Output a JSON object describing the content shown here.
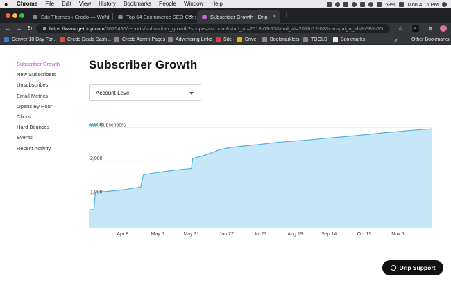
{
  "menubar": {
    "app": "Chrome",
    "items": [
      "File",
      "Edit",
      "View",
      "History",
      "Bookmarks",
      "People",
      "Window",
      "Help"
    ],
    "battery": "68%",
    "clock": "Mon 4:16 PM"
  },
  "tabs": [
    {
      "title": "Edit Themes ‹ Credo — WordPr",
      "active": false
    },
    {
      "title": "Top 64 Ecommerce SEO Consu",
      "active": false
    },
    {
      "title": "Subscriber Growth - Drip",
      "active": true
    }
  ],
  "address": {
    "host": "https://www.getdrip.com",
    "path": "/3675496/reports/subscriber_growth?scope=account&start_at=2018-03-13&end_at=2018-12-02&campaign_ids%5B%5D",
    "ext_badge": "JB+"
  },
  "bookmarks": [
    {
      "label": "Denver 10 Day For...",
      "color": "#3b7bd4"
    },
    {
      "label": "Credo Deals Dash...",
      "color": "#d94c3a"
    },
    {
      "label": "Credo Admin Pages",
      "color": "#8a8a8a"
    },
    {
      "label": "Advertising Links",
      "color": "#8a8a8a"
    },
    {
      "label": "Site",
      "color": "#e23b3b"
    },
    {
      "label": "Drive",
      "color": "#f4b400"
    },
    {
      "label": "Bookmarklets",
      "color": "#8a8a8a"
    },
    {
      "label": "TOOLS",
      "color": "#8a8a8a"
    },
    {
      "label": "Bookmarks",
      "color": "#e8eaed"
    }
  ],
  "bookmarks_more": "»",
  "bookmarks_other": "Other Bookmarks",
  "sidebar": {
    "items": [
      {
        "label": "Subscriber Growth",
        "active": true
      },
      {
        "label": "New Subscribers",
        "active": false
      },
      {
        "label": "Unsubscribes",
        "active": false
      },
      {
        "label": "Email Metrics",
        "active": false
      },
      {
        "label": "Opens By Hour",
        "active": false
      },
      {
        "label": "Clicks",
        "active": false
      },
      {
        "label": "Hard Bounces",
        "active": false
      },
      {
        "label": "Events",
        "active": false
      },
      {
        "label": "Recent Activity",
        "active": false
      }
    ]
  },
  "page_title": "Subscriber Growth",
  "scope_select": {
    "value": "Account Level"
  },
  "colors": {
    "accent": "#d63fe0",
    "series_line": "#4fb3e0",
    "series_fill": "#c6e7f8"
  },
  "support_button": {
    "label": "Drip Support"
  },
  "chart_data": {
    "type": "area",
    "series": [
      {
        "name": "Subscribers",
        "points": [
          [
            "2018-03-13",
            550
          ],
          [
            "2018-03-17",
            560
          ],
          [
            "2018-03-18",
            1080
          ],
          [
            "2018-03-27",
            1100
          ],
          [
            "2018-04-03",
            1130
          ],
          [
            "2018-04-10",
            1160
          ],
          [
            "2018-04-17",
            1200
          ],
          [
            "2018-04-22",
            1230
          ],
          [
            "2018-04-24",
            1590
          ],
          [
            "2018-05-01",
            1640
          ],
          [
            "2018-05-10",
            1690
          ],
          [
            "2018-05-20",
            1740
          ],
          [
            "2018-05-31",
            1780
          ],
          [
            "2018-06-01",
            2080
          ],
          [
            "2018-06-08",
            2150
          ],
          [
            "2018-06-15",
            2240
          ],
          [
            "2018-06-22",
            2340
          ],
          [
            "2018-06-29",
            2400
          ],
          [
            "2018-07-10",
            2450
          ],
          [
            "2018-07-23",
            2500
          ],
          [
            "2018-08-05",
            2560
          ],
          [
            "2018-08-19",
            2600
          ],
          [
            "2018-09-01",
            2640
          ],
          [
            "2018-09-14",
            2690
          ],
          [
            "2018-09-24",
            2720
          ],
          [
            "2018-10-05",
            2760
          ],
          [
            "2018-10-15",
            2800
          ],
          [
            "2018-10-27",
            2850
          ],
          [
            "2018-11-06",
            2880
          ],
          [
            "2018-11-18",
            2920
          ],
          [
            "2018-12-02",
            2960
          ]
        ]
      }
    ],
    "x_ticks": [
      {
        "date": "2018-04-08",
        "label": "Apr 8"
      },
      {
        "date": "2018-05-05",
        "label": "May 5"
      },
      {
        "date": "2018-05-31",
        "label": "May 31"
      },
      {
        "date": "2018-06-27",
        "label": "Jun 27"
      },
      {
        "date": "2018-07-23",
        "label": "Jul 23"
      },
      {
        "date": "2018-08-19",
        "label": "Aug 19"
      },
      {
        "date": "2018-09-14",
        "label": "Sep 14"
      },
      {
        "date": "2018-10-11",
        "label": "Oct 11"
      },
      {
        "date": "2018-11-06",
        "label": "Nov 6"
      }
    ],
    "y_ticks": [
      {
        "value": 1000,
        "label": "1,000"
      },
      {
        "value": 2000,
        "label": "2,000"
      },
      {
        "value": 3000,
        "label": "3,000"
      }
    ],
    "xlim": [
      "2018-03-13",
      "2018-12-02"
    ],
    "ylim": [
      0,
      3500
    ],
    "grid": true,
    "legend": "top-left"
  }
}
